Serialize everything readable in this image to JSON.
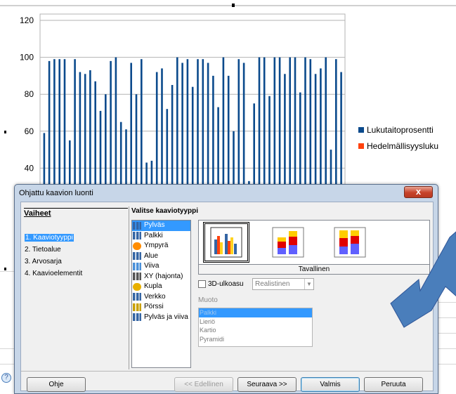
{
  "chart_data": {
    "type": "bar",
    "y_ticks": [
      "120",
      "100",
      "80",
      "60",
      "40"
    ],
    "ylim": [
      0,
      120
    ],
    "visible_range": [
      35,
      120
    ],
    "series": [
      {
        "name": "Lukutaitoprosentti",
        "color": "#0b4a8c",
        "values": [
          59,
          98,
          99,
          99,
          99,
          55,
          99,
          92,
          91,
          93,
          87,
          71,
          80,
          98,
          100,
          65,
          61,
          97,
          80,
          99,
          43,
          44,
          92,
          94,
          72,
          85,
          100,
          97,
          99,
          84,
          99,
          99,
          97,
          90,
          73,
          100,
          90,
          60,
          99,
          97,
          33,
          75,
          100,
          100,
          79,
          100,
          100,
          91,
          100,
          100,
          81,
          100,
          99,
          91,
          94,
          100,
          50,
          99,
          92
        ]
      },
      {
        "name": "Hedelmällisyysluku",
        "color": "#ff420e",
        "values": []
      }
    ],
    "legend_position": "right",
    "grid": true
  },
  "dialog": {
    "title": "Ohjattu kaavion luonti",
    "close_glyph": "x",
    "steps_heading": "Vaiheet",
    "steps": [
      "1. Kaaviotyyppi",
      "2. Tietoalue",
      "3. Arvosarja",
      "4. Kaavioelementit"
    ],
    "type_heading": "Valitse kaaviotyyppi",
    "chart_types": [
      {
        "label": "Pylväs",
        "icon": "column-chart-icon",
        "color": "#3465a4"
      },
      {
        "label": "Palkki",
        "icon": "bar-chart-icon",
        "color": "#3465a4"
      },
      {
        "label": "Ympyrä",
        "icon": "pie-chart-icon",
        "color": "#ff8c00"
      },
      {
        "label": "Alue",
        "icon": "area-chart-icon",
        "color": "#3465a4"
      },
      {
        "label": "Viiva",
        "icon": "line-chart-icon",
        "color": "#4a90d9"
      },
      {
        "label": "XY (hajonta)",
        "icon": "scatter-chart-icon",
        "color": "#555555"
      },
      {
        "label": "Kupla",
        "icon": "bubble-chart-icon",
        "color": "#e8b000"
      },
      {
        "label": "Verkko",
        "icon": "net-chart-icon",
        "color": "#3465a4"
      },
      {
        "label": "Pörssi",
        "icon": "stock-chart-icon",
        "color": "#c9a000"
      },
      {
        "label": "Pylväs ja viiva",
        "icon": "column-line-chart-icon",
        "color": "#3465a4"
      }
    ],
    "variant_label": "Tavallinen",
    "option_3d": "3D-ulkoasu",
    "option_3d_combo": "Realistinen",
    "shape_label": "Muoto",
    "shapes": [
      "Palkki",
      "Lieriö",
      "Kartio",
      "Pyramidi"
    ],
    "buttons": {
      "help": "Ohje",
      "prev": "<< Edellinen",
      "next": "Seuraava >>",
      "finish": "Valmis",
      "cancel": "Peruuta"
    }
  },
  "colors": {
    "arrow_fill": "#4a7ebb",
    "arrow_stroke": "#2f5597",
    "bar": "#0b4a8c",
    "orange": "#ff420e"
  }
}
